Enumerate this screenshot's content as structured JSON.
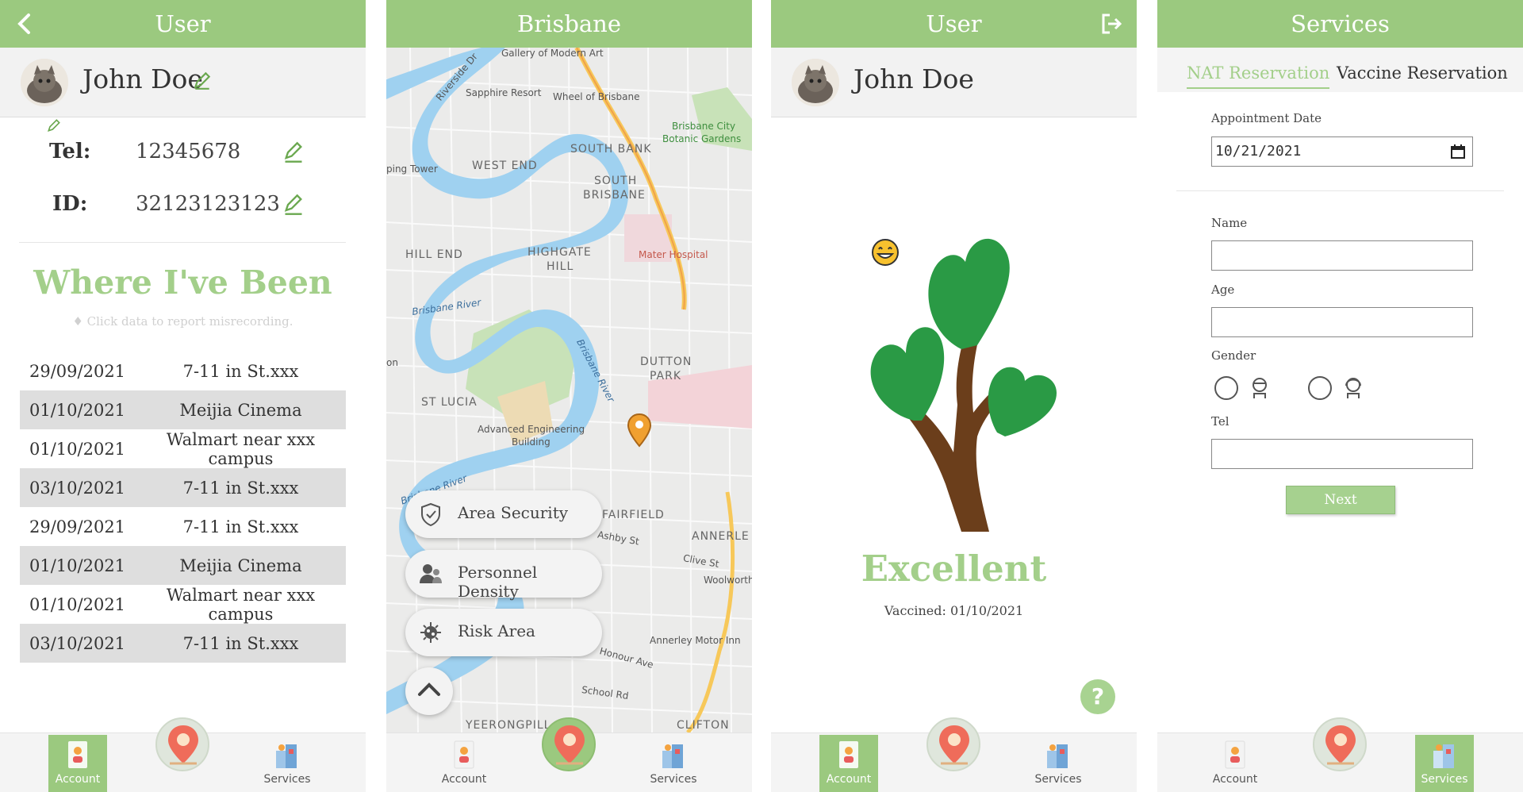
{
  "colors": {
    "accent": "#9bc97f",
    "accent_text": "#a3cf8a",
    "row_alt": "#dedede"
  },
  "screen1": {
    "header_title": "User",
    "back_icon": "chevron-left-icon",
    "profile_name": "John Doe",
    "tel_label": "Tel:",
    "tel_value": "12345678",
    "id_label": "ID:",
    "id_value": "32123123123",
    "where_title": "Where I've Been",
    "where_hint": "♦ Click data to report misrecording.",
    "history": [
      {
        "date": "29/09/2021",
        "place": "7-11 in St.xxx"
      },
      {
        "date": "01/10/2021",
        "place": "Meijia Cinema"
      },
      {
        "date": "01/10/2021",
        "place": "Walmart near xxx campus"
      },
      {
        "date": "03/10/2021",
        "place": "7-11 in St.xxx"
      },
      {
        "date": "29/09/2021",
        "place": "7-11 in St.xxx"
      },
      {
        "date": "01/10/2021",
        "place": "Meijia Cinema"
      },
      {
        "date": "01/10/2021",
        "place": "Walmart near xxx campus"
      },
      {
        "date": "03/10/2021",
        "place": "7-11 in St.xxx"
      }
    ],
    "tabs": {
      "account": "Account",
      "services": "Services"
    }
  },
  "screen2": {
    "header_title": "Brisbane",
    "map_labels": {
      "gallery": "Gallery of Modern Art",
      "sapphire": "Sapphire Resort",
      "wheel": "Wheel of Brisbane",
      "botanic1": "Brisbane City",
      "botanic2": "Botanic Gardens",
      "west_end": "WEST END",
      "south_bank": "SOUTH BANK",
      "south_brisbane1": "SOUTH",
      "south_brisbane2": "BRISBANE",
      "hill_end": "HILL END",
      "highgate1": "HIGHGATE",
      "highgate2": "HILL",
      "mater": "Mater Hospital",
      "river1": "Brisbane River",
      "river2": "Brisbane River",
      "river3": "Brisbane River",
      "dutton1": "DUTTON",
      "dutton2": "PARK",
      "st_lucia": "ST LUCIA",
      "aeb1": "Advanced Engineering",
      "aeb2": "Building",
      "fairfield": "FAIRFIELD",
      "annerley": "ANNERLE",
      "ashby": "Ashby St",
      "clive": "Clive St",
      "woolworth": "Woolworth",
      "annerley_inn": "Annerley Motor Inn",
      "honour": "Honour Ave",
      "school": "School Rd",
      "yeerongpilly": "YEERONGPILL",
      "clifton": "CLIFTON",
      "riverside": "Riverside Dr",
      "tower": "ping Tower",
      "on": "on"
    },
    "buttons": {
      "area_security": "Area Security",
      "personnel_density": "Personnel Density",
      "risk_area": "Risk Area"
    },
    "tabs": {
      "account": "Account",
      "services": "Services"
    }
  },
  "screen3": {
    "header_title": "User",
    "logout_icon": "logout-icon",
    "profile_name": "John Doe",
    "status": "Excellent",
    "vaccined": "Vaccined: 01/10/2021",
    "help": "?",
    "tabs": {
      "account": "Account",
      "services": "Services"
    }
  },
  "screen4": {
    "header_title": "Services",
    "tab_nat": "NAT Reservation",
    "tab_vaccine": "Vaccine Reservation",
    "appointment_label": "Appointment Date",
    "appointment_value": "10/21/2021",
    "name_label": "Name",
    "age_label": "Age",
    "gender_label": "Gender",
    "tel_label": "Tel",
    "next_label": "Next",
    "tabs": {
      "account": "Account",
      "services": "Services"
    }
  }
}
